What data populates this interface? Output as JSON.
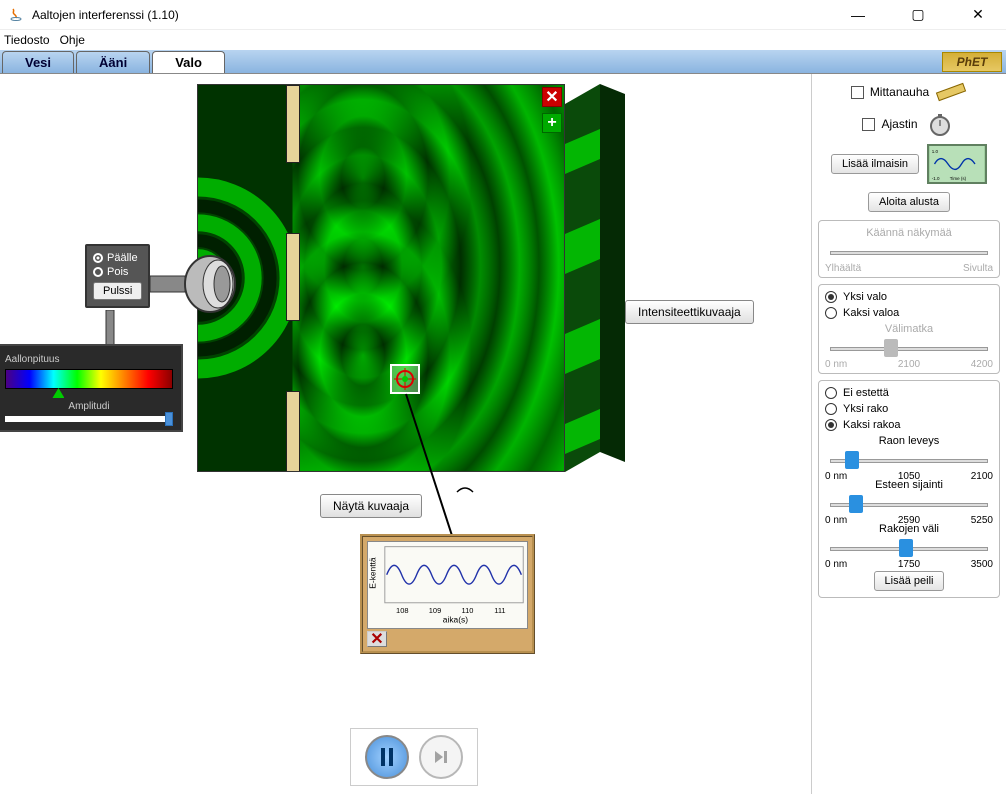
{
  "window": {
    "title": "Aaltojen interferenssi (1.10)"
  },
  "menu": {
    "file": "Tiedosto",
    "help": "Ohje"
  },
  "tabs": {
    "water": "Vesi",
    "sound": "Ääni",
    "light": "Valo"
  },
  "phet": "PhET",
  "source": {
    "on": "Päälle",
    "off": "Pois",
    "pulse": "Pulssi"
  },
  "spectrum": {
    "wavelength": "Aallonpituus",
    "amplitude": "Amplitudi"
  },
  "buttons": {
    "show_graph": "Näytä kuvaaja",
    "intensity_graph": "Intensiteettikuvaaja"
  },
  "graph": {
    "ylabel": "E-kenttä",
    "xlabel": "aika(s)",
    "ticks": {
      "t0": "108",
      "t1": "109",
      "t2": "110",
      "t3": "111"
    }
  },
  "controls": {
    "tape": "Mittanauha",
    "timer": "Ajastin",
    "add_detector": "Lisää ilmaisin",
    "reset": "Aloita alusta",
    "rotate_title": "Käännä näkymää",
    "rotate_left": "Ylhäältä",
    "rotate_right": "Sivulta",
    "one_light": "Yksi valo",
    "two_lights": "Kaksi valoa",
    "spacing_title": "Välimatka",
    "spacing_min": "0 nm",
    "spacing_mid": "2100",
    "spacing_max": "4200",
    "no_barrier": "Ei estettä",
    "one_slit": "Yksi rako",
    "two_slits": "Kaksi rakoa",
    "slit_width": "Raon leveys",
    "sw_min": "0 nm",
    "sw_mid": "1050",
    "sw_max": "2100",
    "barrier_pos": "Esteen sijainti",
    "bp_min": "0 nm",
    "bp_mid": "2590",
    "bp_max": "5250",
    "slit_sep": "Rakojen väli",
    "ss_min": "0 nm",
    "ss_mid": "1750",
    "ss_max": "3500",
    "add_mirror": "Lisää peili"
  },
  "osc": {
    "ymin": "-1.0",
    "ymax": "1.0",
    "xlabel": "Time (s)"
  }
}
